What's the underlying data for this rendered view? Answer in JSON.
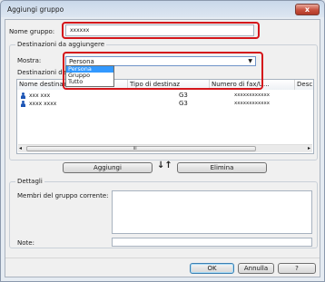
{
  "window": {
    "title": "Aggiungi gruppo",
    "close_glyph": "x"
  },
  "group_name": {
    "label": "Nome gruppo:",
    "value": "xxxxxx"
  },
  "destinations": {
    "title": "Destinazioni da aggiungere",
    "show_label": "Mostra:",
    "show_value": "Persona",
    "options": [
      "Persona",
      "Gruppo",
      "Tutto"
    ],
    "selected_option": "Persona",
    "list_label": "Destinazioni disp",
    "columns": [
      "Nome destinaz",
      "Nome",
      "Tipo di destinaz",
      "Numero di fax/U...",
      "Desc"
    ],
    "rows": [
      {
        "name": "xxx xxx",
        "type": "G3",
        "number": "xxxxxxxxxxxx"
      },
      {
        "name": "xxxx xxxx",
        "type": "G3",
        "number": "xxxxxxxxxxxx"
      }
    ],
    "hscroll_grip": "III"
  },
  "actions": {
    "add_label": "Aggiungi",
    "arrows": "↓↑",
    "delete_label": "Elimina"
  },
  "details": {
    "title": "Dettagli",
    "members_label": "Membri del gruppo corrente:",
    "notes_label": "Note:"
  },
  "footer": {
    "ok_label": "OK",
    "cancel_label": "Annulla",
    "help_label": "?"
  }
}
